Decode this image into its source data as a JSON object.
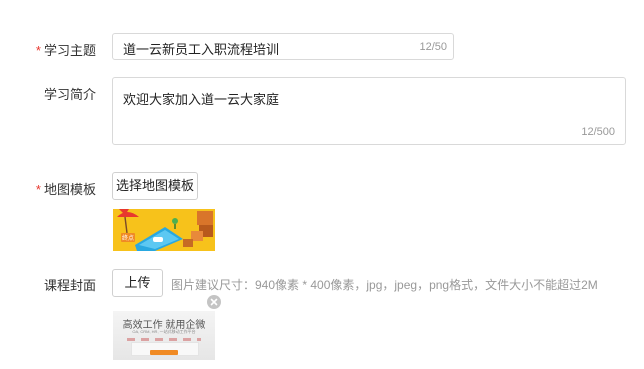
{
  "form": {
    "topic": {
      "label": "学习主题",
      "required": true,
      "value": "道一云新员工入职流程培训",
      "counter": "12/50"
    },
    "intro": {
      "label": "学习简介",
      "required": false,
      "value": "欢迎大家加入道一云大家庭",
      "counter": "12/500"
    },
    "map_template": {
      "label": "地图模板",
      "required": true,
      "button_label": "选择地图模板",
      "thumbnail_icon": "map-theme-image"
    },
    "cover": {
      "label": "课程封面",
      "required": false,
      "upload_label": "上传",
      "hint": "图片建议尺寸：940像素 * 400像素，jpg，jpeg，png格式，文件大小不能超过2M",
      "thumbnail_icon": "cover-image",
      "delete_icon": "close-circle-icon",
      "banner_title": "高效工作 就用企微",
      "banner_subtitle": "OA, CRM, HR, 一站式移动工作平台"
    }
  },
  "colors": {
    "required": "#e8372e",
    "border": "#d9d9d9",
    "hint": "#999999",
    "map_yellow": "#f7c21b",
    "map_blue": "#29a8e0",
    "cover_orange": "#f08a24"
  }
}
